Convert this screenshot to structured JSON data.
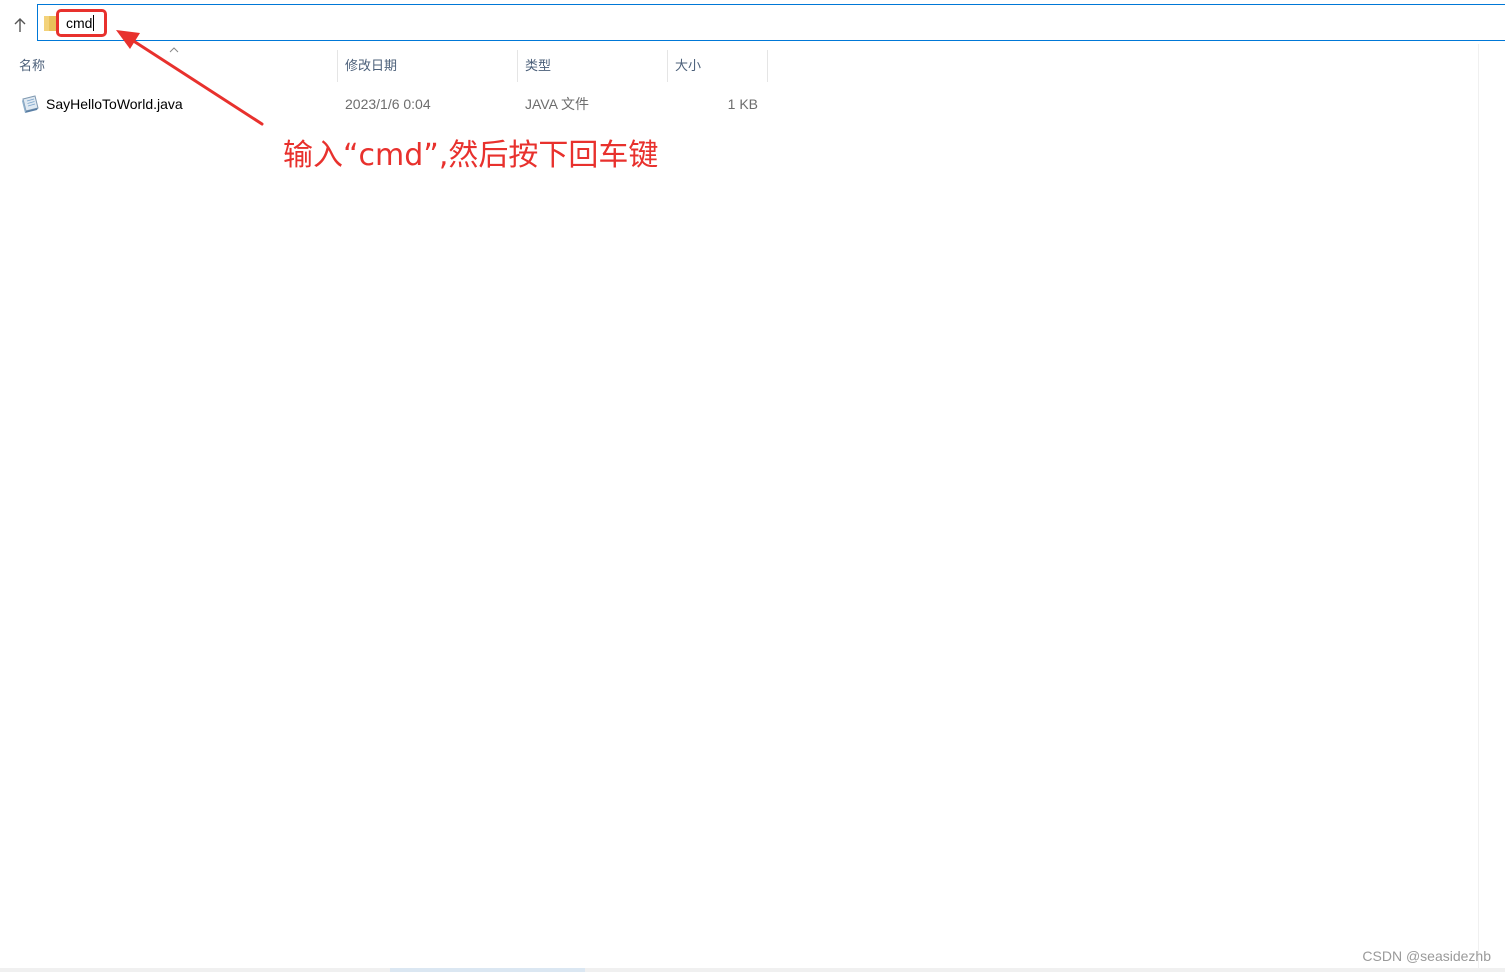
{
  "address_bar": {
    "value": "cmd"
  },
  "columns": {
    "name": "名称",
    "modified": "修改日期",
    "type": "类型",
    "size": "大小",
    "sorted_by": "name",
    "sort_direction": "ascending"
  },
  "files": [
    {
      "name": "SayHelloToWorld.java",
      "modified": "2023/1/6 0:04",
      "type": "JAVA 文件",
      "size": "1 KB",
      "icon": "java-file-icon"
    }
  ],
  "annotation": {
    "text": "输入“cmd”,然后按下回车键",
    "color": "#e8312d"
  },
  "watermark": "CSDN @seasidezhb",
  "colors": {
    "accent": "#0078d7",
    "annotation_red": "#e8312d",
    "header_text": "#4c607a",
    "secondary_text": "#6d6d6d"
  }
}
